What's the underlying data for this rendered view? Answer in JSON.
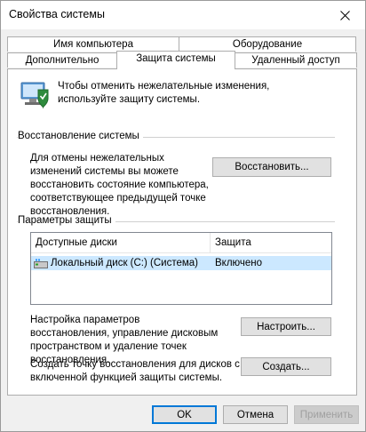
{
  "window": {
    "title": "Свойства системы"
  },
  "tabs": {
    "row1": [
      "Имя компьютера",
      "Оборудование"
    ],
    "row2": [
      "Дополнительно",
      "Защита системы",
      "Удаленный доступ"
    ],
    "active": "Защита системы"
  },
  "intro_text": "Чтобы отменить нежелательные изменения, используйте защиту системы.",
  "restore": {
    "group_title": "Восстановление системы",
    "description": "Для отмены нежелательных изменений системы вы можете восстановить состояние компьютера, соответствующее предыдущей точке восстановления.",
    "button_label": "Восстановить..."
  },
  "protection": {
    "group_title": "Параметры защиты",
    "columns": [
      "Доступные диски",
      "Защита"
    ],
    "rows": [
      {
        "drive": "Локальный диск (C:) (Система)",
        "status": "Включено",
        "icon": "drive-icon"
      }
    ],
    "configure_text": "Настройка параметров восстановления, управление дисковым пространством и удаление точек восстановления.",
    "configure_button": "Настроить...",
    "create_text": "Создать точку восстановления для дисков с включенной функцией защиты системы.",
    "create_button": "Создать..."
  },
  "footer": {
    "ok": "OK",
    "cancel": "Отмена",
    "apply": "Применить"
  },
  "colors": {
    "selection": "#cce8ff",
    "accent": "#0078d7",
    "panel": "#ffffff",
    "window_bg": "#f0f0f0"
  }
}
